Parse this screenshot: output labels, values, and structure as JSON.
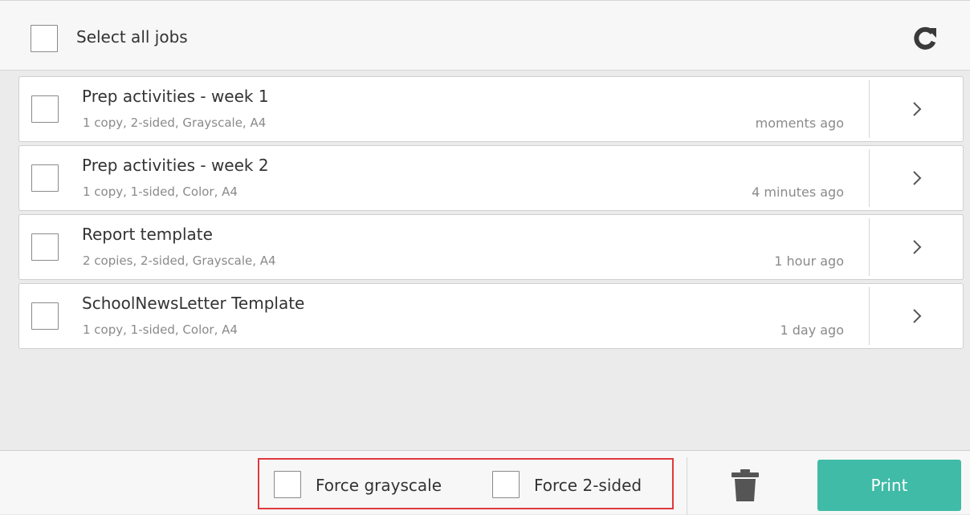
{
  "header": {
    "select_all_label": "Select all jobs",
    "refresh_icon": "refresh-icon"
  },
  "jobs": [
    {
      "title": "Prep activities - week 1",
      "details": "1 copy, 2-sided, Grayscale, A4",
      "time": "moments ago",
      "arrow_icon": "chevron-right-icon"
    },
    {
      "title": "Prep activities - week 2",
      "details": "1 copy, 1-sided, Color, A4",
      "time": "4 minutes ago",
      "arrow_icon": "chevron-right-icon"
    },
    {
      "title": "Report template",
      "details": "2 copies, 2-sided, Grayscale, A4",
      "time": "1 hour ago",
      "arrow_icon": "chevron-right-icon"
    },
    {
      "title": "SchoolNewsLetter Template",
      "details": "1 copy, 1-sided, Color, A4",
      "time": "1 day ago",
      "arrow_icon": "chevron-right-icon"
    }
  ],
  "footer": {
    "force_grayscale_label": "Force grayscale",
    "force_2sided_label": "Force 2-sided",
    "delete_icon": "trash-icon",
    "print_label": "Print"
  },
  "colors": {
    "accent": "#40bba7",
    "highlight_border": "#e0393e",
    "background": "#ebebeb"
  }
}
